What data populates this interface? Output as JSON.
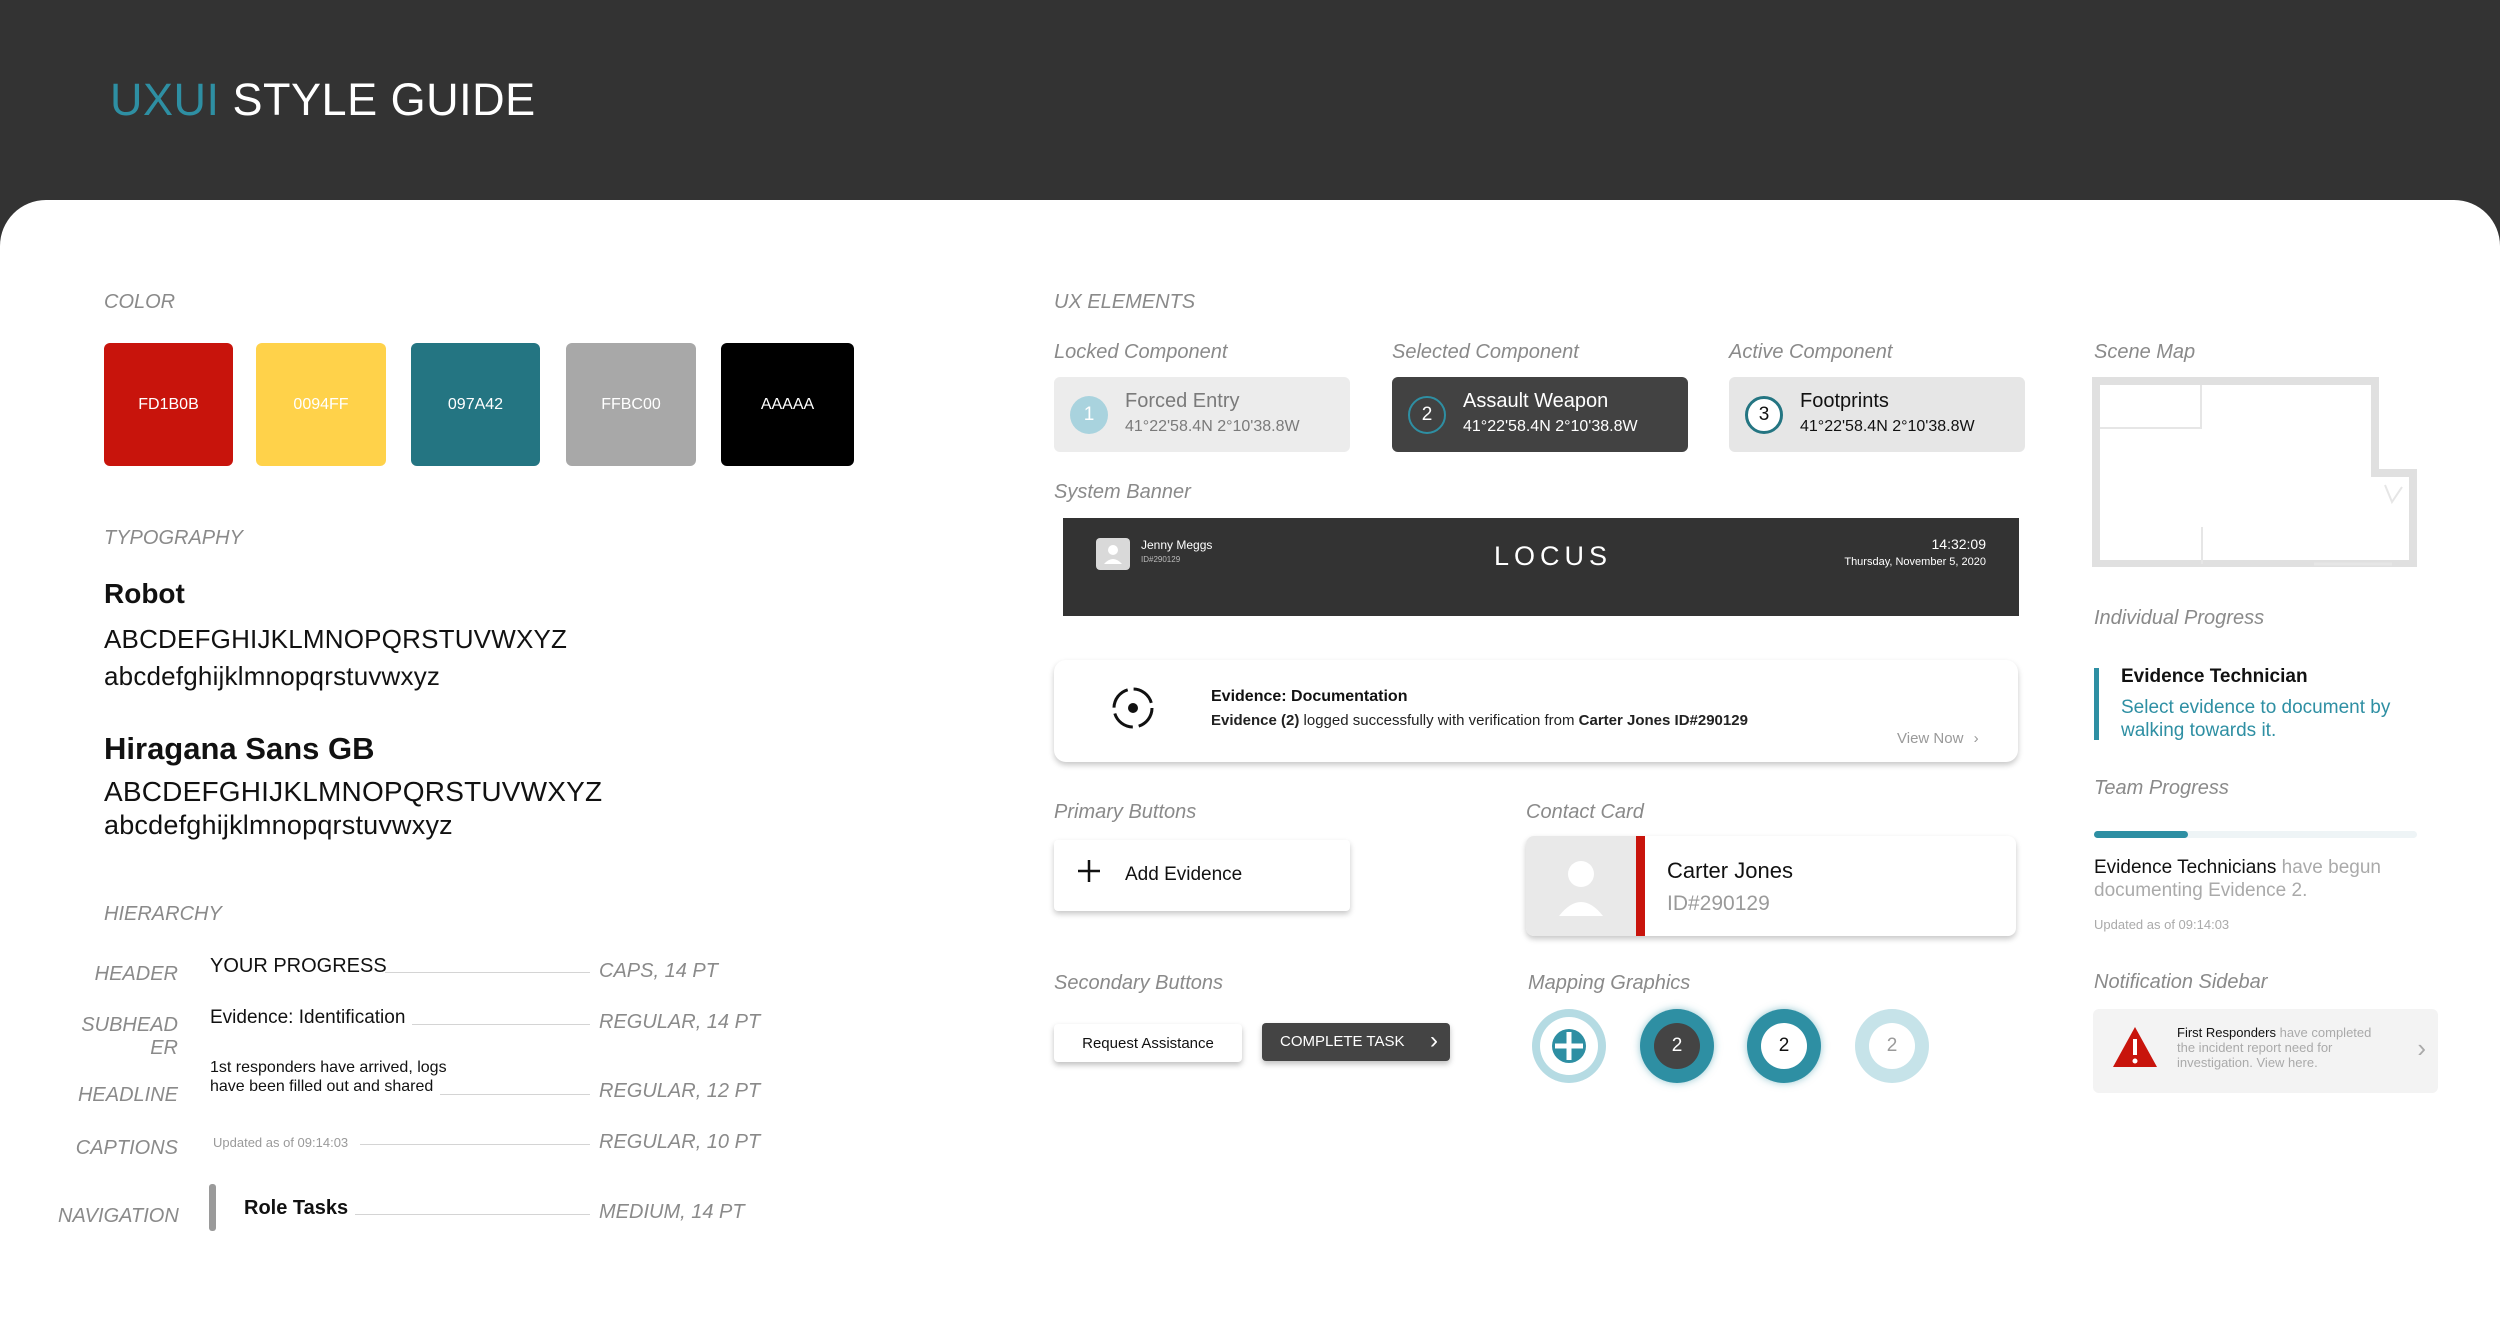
{
  "header": {
    "title_accent": "UXUI",
    "title_rest": "STYLE GUIDE"
  },
  "color": {
    "label": "COLOR",
    "swatches": [
      {
        "name": "FD1B0B",
        "color": "#c8140c"
      },
      {
        "name": "0094FF",
        "color": "#ffd24a"
      },
      {
        "name": "097A42",
        "color": "#247582"
      },
      {
        "name": "FFBC00",
        "color": "#a8a8a8"
      },
      {
        "name": "AAAAA",
        "color": "#000000"
      }
    ]
  },
  "typography": {
    "label": "TYPOGRAPHY",
    "fonts": [
      {
        "name": "Robot",
        "upper": "ABCDEFGHIJKLMNOPQRSTUVWXYZ",
        "lower": "abcdefghijklmnopqrstuvwxyz"
      },
      {
        "name": "Hiragana Sans GB",
        "upper": "ABCDEFGHIJKLMNOPQRSTUVWXYZ",
        "lower": "abcdefghijklmnopqrstuvwxyz"
      }
    ]
  },
  "hierarchy": {
    "label": "HIERARCHY",
    "rows": [
      {
        "label": "HEADER",
        "sample": "YOUR PROGRESS",
        "spec": "CAPS, 14 PT"
      },
      {
        "label": "SUBHEAD ER",
        "sample": "Evidence: Identification",
        "spec": "REGULAR, 14 PT"
      },
      {
        "label": "HEADLINE",
        "sample_line1": "1st responders have arrived, logs",
        "sample_line2": "have been filled out and shared",
        "spec": "REGULAR, 12 PT"
      },
      {
        "label": "CAPTIONS",
        "sample": "Updated as of 09:14:03",
        "spec": "REGULAR, 10 PT"
      },
      {
        "label": "NAVIGATION",
        "sample": "Role Tasks",
        "spec": "MEDIUM, 14 PT"
      }
    ]
  },
  "ux": {
    "label": "UX ELEMENTS",
    "locked": {
      "label": "Locked Component",
      "num": "1",
      "title": "Forced Entry",
      "coords": "41°22'58.4N 2°10'38.8W"
    },
    "selected": {
      "label": "Selected Component",
      "num": "2",
      "title": "Assault Weapon",
      "coords": "41°22'58.4N 2°10'38.8W"
    },
    "active": {
      "label": "Active Component",
      "num": "3",
      "title": "Footprints",
      "coords": "41°22'58.4N 2°10'38.8W"
    },
    "system_banner": {
      "label": "System Banner",
      "user_name": "Jenny Meggs",
      "user_id": "ID#290129",
      "logo": "LOCUS",
      "time": "14:32:09",
      "date": "Thursday, November 5, 2020"
    },
    "notification": {
      "title": "Evidence: Documentation",
      "msg_bold1": "Evidence (2)",
      "msg_mid": " logged successfully with verification from ",
      "msg_bold2": "Carter Jones ID#290129",
      "link": "View Now"
    },
    "primary_buttons": {
      "label": "Primary Buttons",
      "add_label": "Add Evidence"
    },
    "contact_card": {
      "label": "Contact Card",
      "name": "Carter Jones",
      "id": "ID#290129"
    },
    "secondary_buttons": {
      "label": "Secondary Buttons",
      "request_label": "Request Assistance",
      "complete_label": "COMPLETE TASK"
    },
    "mapping": {
      "label": "Mapping Graphics",
      "marker_num": "2"
    }
  },
  "sidebar": {
    "scene_map_label": "Scene Map",
    "individual": {
      "label": "Individual Progress",
      "title": "Evidence Technician",
      "body": "Select evidence to document by walking towards it."
    },
    "team": {
      "label": "Team Progress",
      "progress": 0.29,
      "bold": "Evidence Technicians",
      "rest": " have begun documenting Evidence 2.",
      "updated": "Updated as of 09:14:03"
    },
    "notification": {
      "label": "Notification Sidebar",
      "bold": "First Responders",
      "rest": " have completed the incident report need for investigation. View here."
    }
  },
  "colors": {
    "accent": "#2e8fa3",
    "dark": "#333333",
    "alert": "#c8140c"
  }
}
